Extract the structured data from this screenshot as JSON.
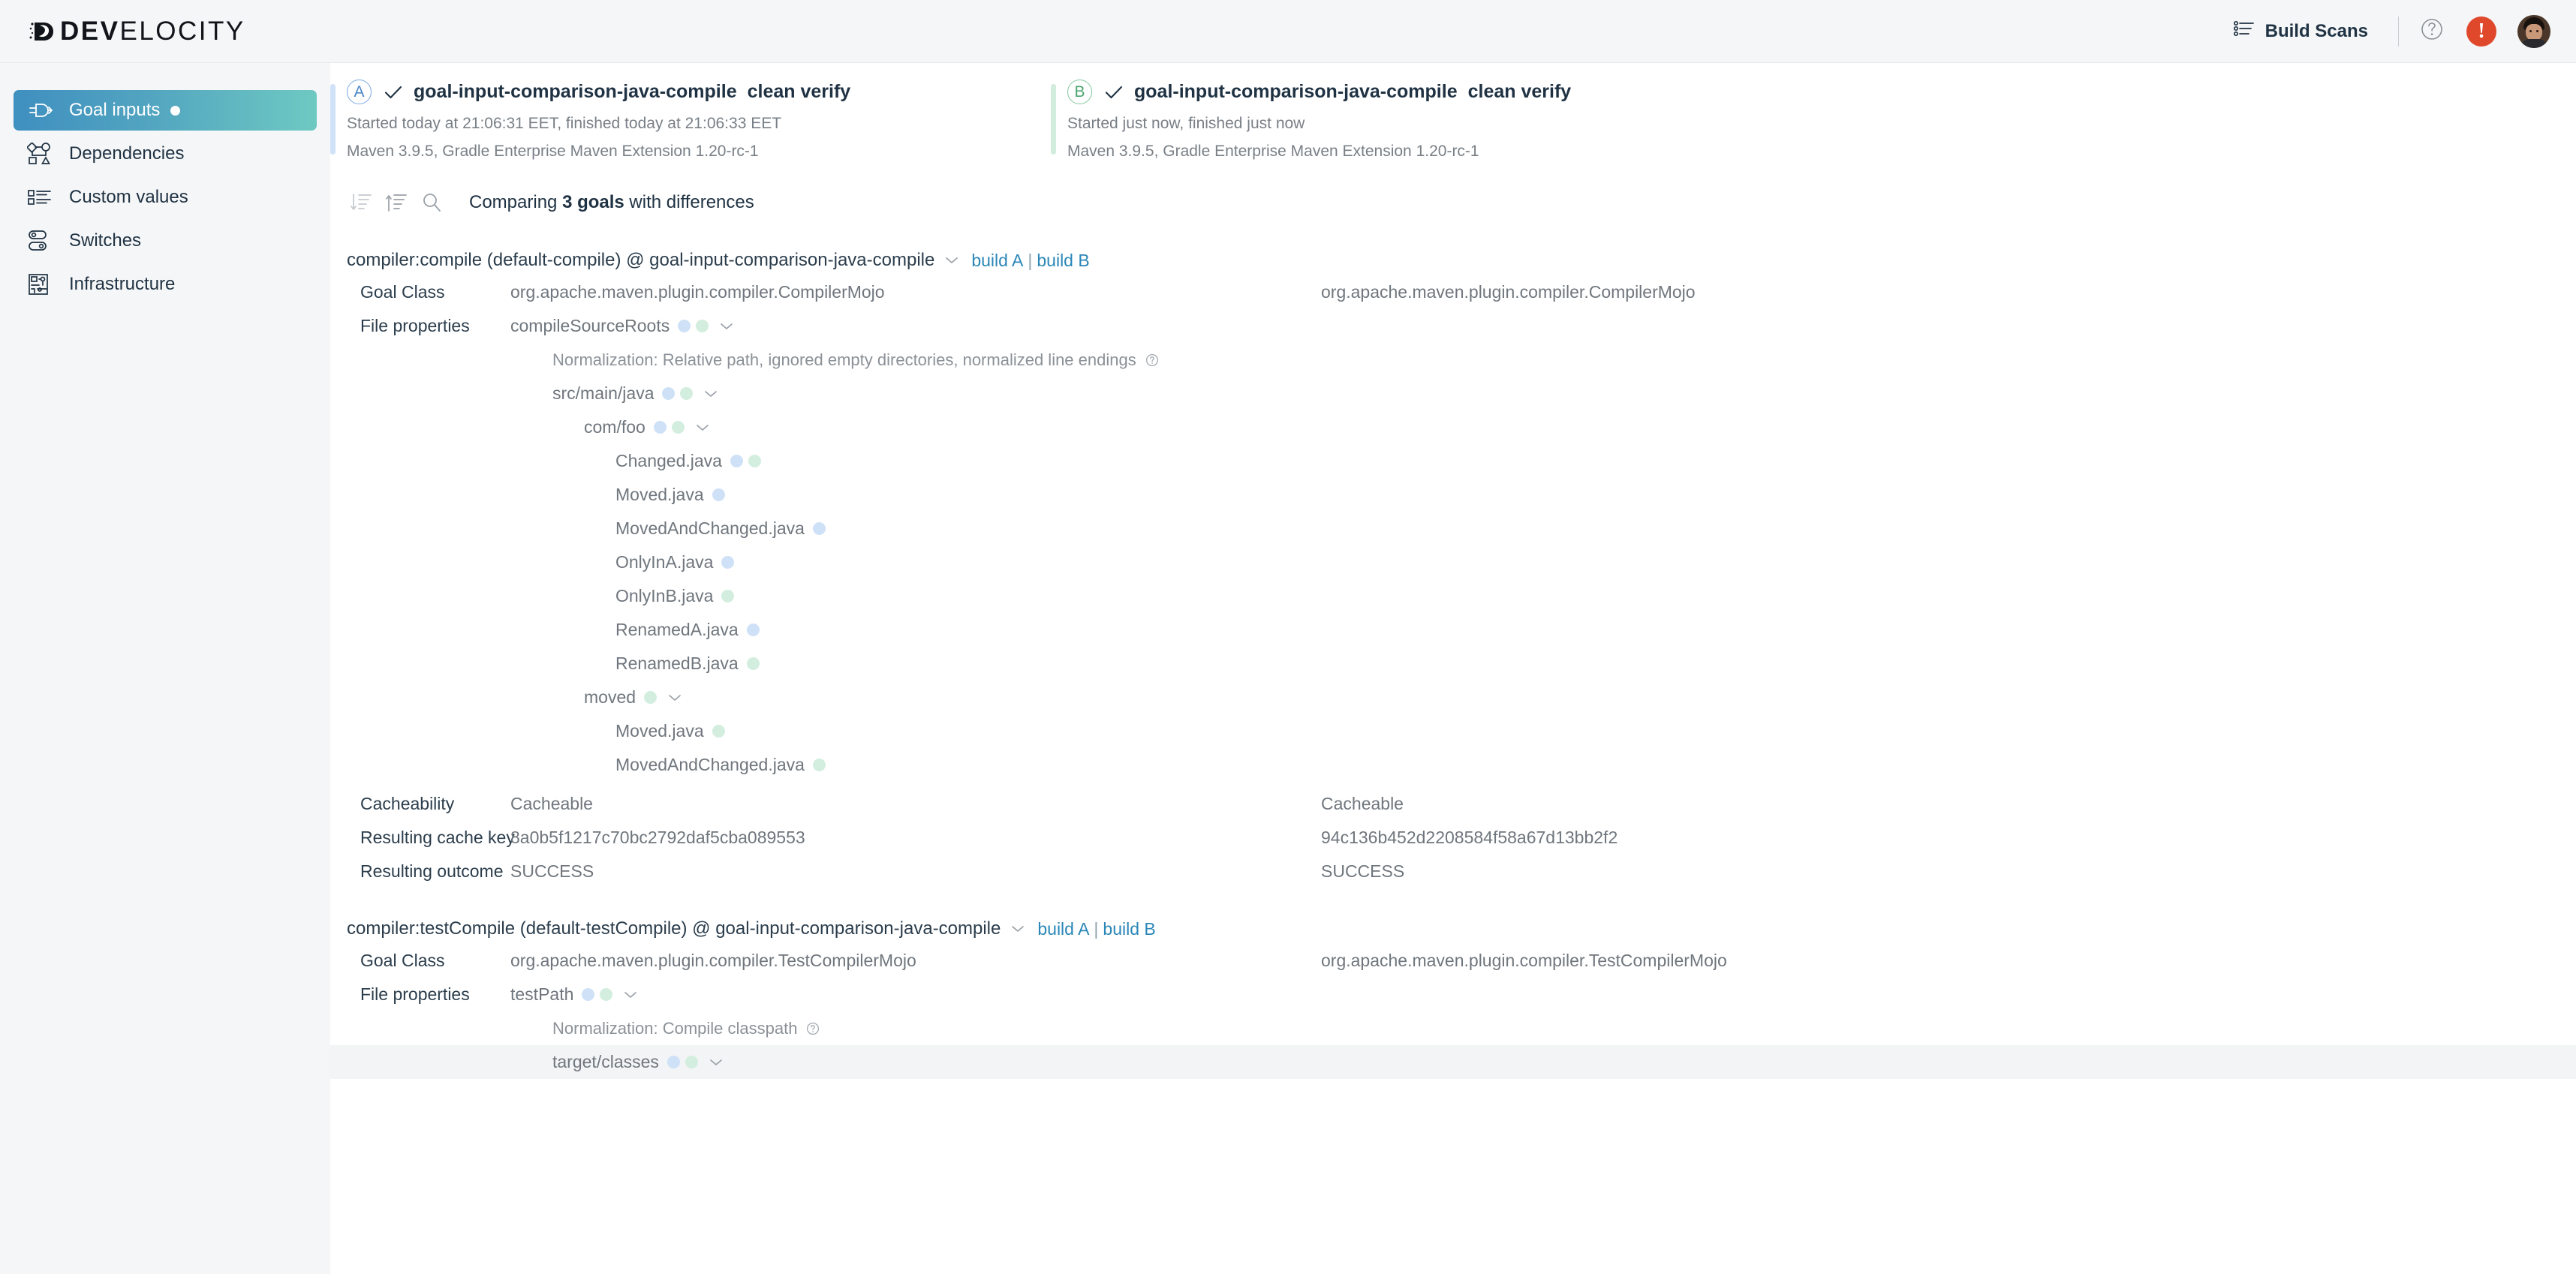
{
  "header": {
    "logo_bold": "DEV",
    "logo_light": "ELOCITY",
    "logo_icon": "develocity-logo-icon",
    "build_scans_label": "Build Scans",
    "build_scans_icon": "bulleted-list-icon",
    "help_icon": "question-circle-icon",
    "alert_icon": "alert-exclamation-icon",
    "alert_glyph": "!",
    "alert_color": "#e0482c",
    "avatar_name": "user-avatar"
  },
  "sidebar": {
    "items": [
      {
        "label": "Goal inputs",
        "icon": "plug-icon",
        "active": true,
        "badge_dot": true
      },
      {
        "label": "Dependencies",
        "icon": "dependency-graph-icon",
        "active": false,
        "badge_dot": false
      },
      {
        "label": "Custom values",
        "icon": "list-values-icon",
        "active": false,
        "badge_dot": false
      },
      {
        "label": "Switches",
        "icon": "toggle-switches-icon",
        "active": false,
        "badge_dot": false
      },
      {
        "label": "Infrastructure",
        "icon": "infrastructure-chip-icon",
        "active": false,
        "badge_dot": false
      }
    ],
    "active_gradient_from": "#3f8fc0",
    "active_gradient_to": "#6ec9c2"
  },
  "builds": {
    "a": {
      "badge": "A",
      "badge_color": "#4a86c8",
      "accent": "#cfe2f7",
      "status_icon": "check-icon",
      "project": "goal-input-comparison-java-compile",
      "goals": "clean verify",
      "timing": "Started today at 21:06:31 EET, finished today at 21:06:33 EET",
      "tooling": "Maven 3.9.5,  Gradle Enterprise Maven Extension 1.20-rc-1"
    },
    "b": {
      "badge": "B",
      "badge_color": "#4ba56f",
      "accent": "#d2ecdd",
      "status_icon": "check-icon",
      "project": "goal-input-comparison-java-compile",
      "goals": "clean verify",
      "timing": "Started just now, finished just now",
      "tooling": "Maven 3.9.5,  Gradle Enterprise Maven Extension 1.20-rc-1"
    }
  },
  "toolbar": {
    "collapse_all_icon": "collapse-all-icon",
    "expand_all_icon": "expand-all-icon",
    "search_icon": "search-icon",
    "summary_prefix": "Comparing ",
    "summary_count": "3 goals",
    "summary_suffix": " with differences"
  },
  "labels": {
    "goal_class": "Goal Class",
    "file_properties": "File properties",
    "cacheability": "Cacheability",
    "resulting_cache_key": "Resulting cache key",
    "resulting_outcome": "Resulting outcome",
    "build_a_link": "build A",
    "build_b_link": "build B",
    "link_separator": "|"
  },
  "goals": [
    {
      "title": "compiler:compile (default-compile) @ goal-input-comparison-java-compile",
      "goal_class_a": "org.apache.maven.plugin.compiler.CompilerMojo",
      "goal_class_b": "org.apache.maven.plugin.compiler.CompilerMojo",
      "file_property": "compileSourceRoots",
      "file_property_dots": [
        "a",
        "b"
      ],
      "normalization": "Normalization: Relative path, ignored empty directories, normalized line endings",
      "tree": [
        {
          "name": "src/main/java",
          "indent": 0,
          "dots": [
            "a",
            "b"
          ],
          "chevron": true
        },
        {
          "name": "com/foo",
          "indent": 1,
          "dots": [
            "a",
            "b"
          ],
          "chevron": true
        },
        {
          "name": "Changed.java",
          "indent": 2,
          "dots": [
            "a",
            "b"
          ],
          "chevron": false
        },
        {
          "name": "Moved.java",
          "indent": 2,
          "dots": [
            "a"
          ],
          "chevron": false
        },
        {
          "name": "MovedAndChanged.java",
          "indent": 2,
          "dots": [
            "a"
          ],
          "chevron": false
        },
        {
          "name": "OnlyInA.java",
          "indent": 2,
          "dots": [
            "a"
          ],
          "chevron": false
        },
        {
          "name": "OnlyInB.java",
          "indent": 2,
          "dots": [
            "b"
          ],
          "chevron": false
        },
        {
          "name": "RenamedA.java",
          "indent": 2,
          "dots": [
            "a"
          ],
          "chevron": false
        },
        {
          "name": "RenamedB.java",
          "indent": 2,
          "dots": [
            "b"
          ],
          "chevron": false
        },
        {
          "name": "moved",
          "indent": 1,
          "dots": [
            "b"
          ],
          "chevron": true
        },
        {
          "name": "Moved.java",
          "indent": 2,
          "dots": [
            "b"
          ],
          "chevron": false
        },
        {
          "name": "MovedAndChanged.java",
          "indent": 2,
          "dots": [
            "b"
          ],
          "chevron": false
        }
      ],
      "cacheability_a": "Cacheable",
      "cacheability_b": "Cacheable",
      "cache_key_a": "8a0b5f1217c70bc2792daf5cba089553",
      "cache_key_b": "94c136b452d2208584f58a67d13bb2f2",
      "outcome_a": "SUCCESS",
      "outcome_b": "SUCCESS"
    },
    {
      "title": "compiler:testCompile (default-testCompile) @ goal-input-comparison-java-compile",
      "goal_class_a": "org.apache.maven.plugin.compiler.TestCompilerMojo",
      "goal_class_b": "org.apache.maven.plugin.compiler.TestCompilerMojo",
      "file_property": "testPath",
      "file_property_dots": [
        "a",
        "b"
      ],
      "normalization": "Normalization: Compile classpath",
      "tree": [
        {
          "name": "target/classes",
          "indent": 0,
          "dots": [
            "a",
            "b"
          ],
          "chevron": true,
          "hovered": true,
          "gutter_icon": "link-chain-icon"
        }
      ]
    }
  ]
}
